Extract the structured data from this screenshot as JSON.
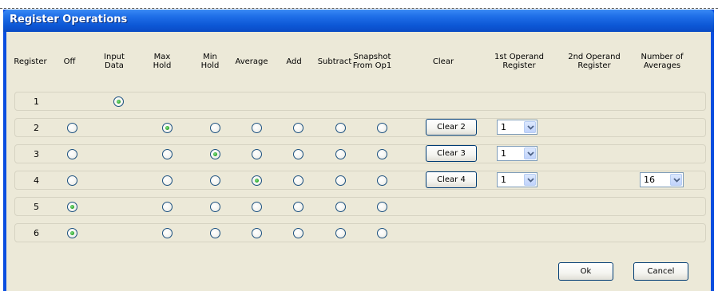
{
  "window": {
    "title": "Register Operations"
  },
  "headers": {
    "register": "Register",
    "off": "Off",
    "input_data": "Input\nData",
    "max_hold": "Max\nHold",
    "min_hold": "Min\nHold",
    "average": "Average",
    "add": "Add",
    "subtract": "Subtract",
    "snapshot": "Snapshot\nFrom Op1",
    "clear": "Clear",
    "op1": "1st Operand\nRegister",
    "op2": "2nd Operand\nRegister",
    "num_avg": "Number of\nAverages"
  },
  "rows": [
    {
      "number": "1",
      "selected": "input_data"
    },
    {
      "number": "2",
      "selected": "max_hold",
      "clear_label": "Clear 2",
      "op1": "1"
    },
    {
      "number": "3",
      "selected": "min_hold",
      "clear_label": "Clear 3",
      "op1": "1"
    },
    {
      "number": "4",
      "selected": "average",
      "clear_label": "Clear 4",
      "op1": "1",
      "averages": "16"
    },
    {
      "number": "5",
      "selected": "off"
    },
    {
      "number": "6",
      "selected": "off"
    }
  ],
  "buttons": {
    "ok": "Ok",
    "cancel": "Cancel"
  }
}
